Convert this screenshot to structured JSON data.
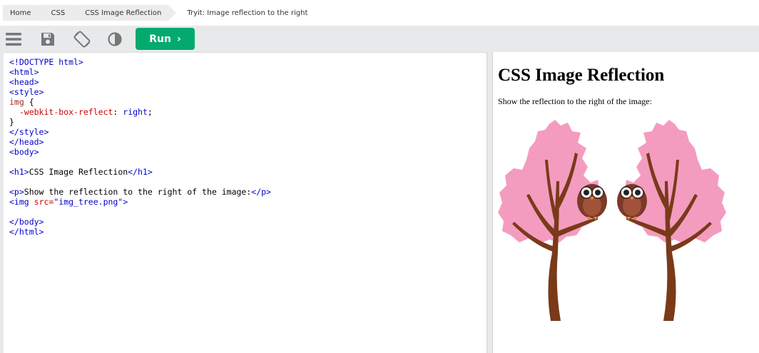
{
  "breadcrumb": {
    "items": [
      "Home",
      "CSS",
      "CSS Image Reflection"
    ],
    "current": "Tryit: Image reflection to the right"
  },
  "toolbar": {
    "run_label": "Run",
    "icons": [
      "menu-icon",
      "save-icon",
      "rotate-icon",
      "contrast-icon"
    ],
    "accent": "#04aa6d"
  },
  "code_lines": [
    "<!DOCTYPE html>",
    "<html>",
    "<head>",
    "<style>",
    "img {",
    "  -webkit-box-reflect: right;",
    "}",
    "</style>",
    "</head>",
    "<body>",
    "",
    "<h1>CSS Image Reflection</h1>",
    "",
    "<p>Show the reflection to the right of the image:</p>",
    "<img src=\"img_tree.png\">",
    "",
    "</body>",
    "</html>"
  ],
  "result": {
    "heading": "CSS Image Reflection",
    "paragraph": "Show the reflection to the right of the image:"
  }
}
